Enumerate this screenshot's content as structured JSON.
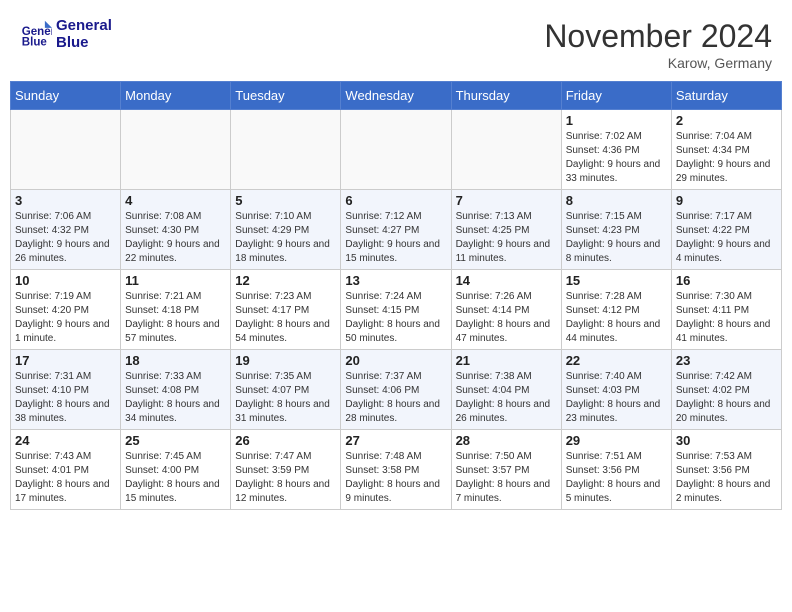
{
  "header": {
    "logo_line1": "General",
    "logo_line2": "Blue",
    "month": "November 2024",
    "location": "Karow, Germany"
  },
  "weekdays": [
    "Sunday",
    "Monday",
    "Tuesday",
    "Wednesday",
    "Thursday",
    "Friday",
    "Saturday"
  ],
  "weeks": [
    [
      {
        "day": "",
        "info": ""
      },
      {
        "day": "",
        "info": ""
      },
      {
        "day": "",
        "info": ""
      },
      {
        "day": "",
        "info": ""
      },
      {
        "day": "",
        "info": ""
      },
      {
        "day": "1",
        "info": "Sunrise: 7:02 AM\nSunset: 4:36 PM\nDaylight: 9 hours and 33 minutes."
      },
      {
        "day": "2",
        "info": "Sunrise: 7:04 AM\nSunset: 4:34 PM\nDaylight: 9 hours and 29 minutes."
      }
    ],
    [
      {
        "day": "3",
        "info": "Sunrise: 7:06 AM\nSunset: 4:32 PM\nDaylight: 9 hours and 26 minutes."
      },
      {
        "day": "4",
        "info": "Sunrise: 7:08 AM\nSunset: 4:30 PM\nDaylight: 9 hours and 22 minutes."
      },
      {
        "day": "5",
        "info": "Sunrise: 7:10 AM\nSunset: 4:29 PM\nDaylight: 9 hours and 18 minutes."
      },
      {
        "day": "6",
        "info": "Sunrise: 7:12 AM\nSunset: 4:27 PM\nDaylight: 9 hours and 15 minutes."
      },
      {
        "day": "7",
        "info": "Sunrise: 7:13 AM\nSunset: 4:25 PM\nDaylight: 9 hours and 11 minutes."
      },
      {
        "day": "8",
        "info": "Sunrise: 7:15 AM\nSunset: 4:23 PM\nDaylight: 9 hours and 8 minutes."
      },
      {
        "day": "9",
        "info": "Sunrise: 7:17 AM\nSunset: 4:22 PM\nDaylight: 9 hours and 4 minutes."
      }
    ],
    [
      {
        "day": "10",
        "info": "Sunrise: 7:19 AM\nSunset: 4:20 PM\nDaylight: 9 hours and 1 minute."
      },
      {
        "day": "11",
        "info": "Sunrise: 7:21 AM\nSunset: 4:18 PM\nDaylight: 8 hours and 57 minutes."
      },
      {
        "day": "12",
        "info": "Sunrise: 7:23 AM\nSunset: 4:17 PM\nDaylight: 8 hours and 54 minutes."
      },
      {
        "day": "13",
        "info": "Sunrise: 7:24 AM\nSunset: 4:15 PM\nDaylight: 8 hours and 50 minutes."
      },
      {
        "day": "14",
        "info": "Sunrise: 7:26 AM\nSunset: 4:14 PM\nDaylight: 8 hours and 47 minutes."
      },
      {
        "day": "15",
        "info": "Sunrise: 7:28 AM\nSunset: 4:12 PM\nDaylight: 8 hours and 44 minutes."
      },
      {
        "day": "16",
        "info": "Sunrise: 7:30 AM\nSunset: 4:11 PM\nDaylight: 8 hours and 41 minutes."
      }
    ],
    [
      {
        "day": "17",
        "info": "Sunrise: 7:31 AM\nSunset: 4:10 PM\nDaylight: 8 hours and 38 minutes."
      },
      {
        "day": "18",
        "info": "Sunrise: 7:33 AM\nSunset: 4:08 PM\nDaylight: 8 hours and 34 minutes."
      },
      {
        "day": "19",
        "info": "Sunrise: 7:35 AM\nSunset: 4:07 PM\nDaylight: 8 hours and 31 minutes."
      },
      {
        "day": "20",
        "info": "Sunrise: 7:37 AM\nSunset: 4:06 PM\nDaylight: 8 hours and 28 minutes."
      },
      {
        "day": "21",
        "info": "Sunrise: 7:38 AM\nSunset: 4:04 PM\nDaylight: 8 hours and 26 minutes."
      },
      {
        "day": "22",
        "info": "Sunrise: 7:40 AM\nSunset: 4:03 PM\nDaylight: 8 hours and 23 minutes."
      },
      {
        "day": "23",
        "info": "Sunrise: 7:42 AM\nSunset: 4:02 PM\nDaylight: 8 hours and 20 minutes."
      }
    ],
    [
      {
        "day": "24",
        "info": "Sunrise: 7:43 AM\nSunset: 4:01 PM\nDaylight: 8 hours and 17 minutes."
      },
      {
        "day": "25",
        "info": "Sunrise: 7:45 AM\nSunset: 4:00 PM\nDaylight: 8 hours and 15 minutes."
      },
      {
        "day": "26",
        "info": "Sunrise: 7:47 AM\nSunset: 3:59 PM\nDaylight: 8 hours and 12 minutes."
      },
      {
        "day": "27",
        "info": "Sunrise: 7:48 AM\nSunset: 3:58 PM\nDaylight: 8 hours and 9 minutes."
      },
      {
        "day": "28",
        "info": "Sunrise: 7:50 AM\nSunset: 3:57 PM\nDaylight: 8 hours and 7 minutes."
      },
      {
        "day": "29",
        "info": "Sunrise: 7:51 AM\nSunset: 3:56 PM\nDaylight: 8 hours and 5 minutes."
      },
      {
        "day": "30",
        "info": "Sunrise: 7:53 AM\nSunset: 3:56 PM\nDaylight: 8 hours and 2 minutes."
      }
    ]
  ]
}
